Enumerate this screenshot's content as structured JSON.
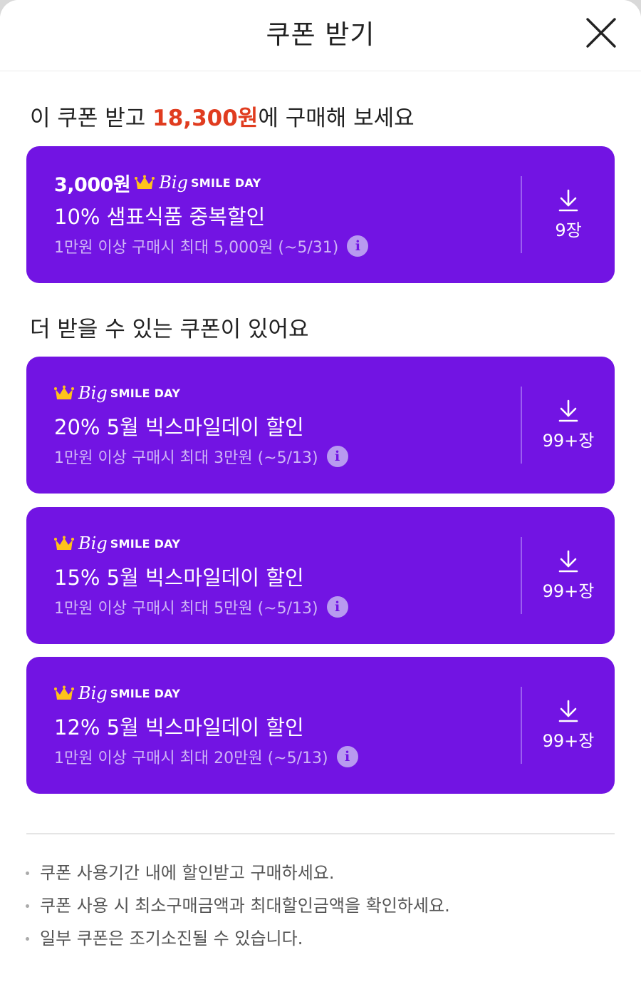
{
  "header": {
    "title": "쿠폰 받기"
  },
  "applied": {
    "title_prefix": "이 쿠폰 받고 ",
    "price": "18,300원",
    "title_suffix": "에 구매해 보세요",
    "coupon": {
      "amount": "3,000원",
      "brand_big": "Big",
      "brand_smile": "SMILE DAY",
      "title": "10% 샘표식품 중복할인",
      "condition": "1만원 이상 구매시 최대 5,000원 (~5/31)",
      "count": "9장"
    }
  },
  "more": {
    "title": "더 받을 수 있는 쿠폰이 있어요",
    "coupons": [
      {
        "brand_big": "Big",
        "brand_smile": "SMILE DAY",
        "title": "20% 5월 빅스마일데이 할인",
        "condition": "1만원 이상 구매시 최대 3만원 (~5/13)",
        "count": "99+장"
      },
      {
        "brand_big": "Big",
        "brand_smile": "SMILE DAY",
        "title": "15% 5월 빅스마일데이 할인",
        "condition": "1만원 이상 구매시 최대 5만원 (~5/13)",
        "count": "99+장"
      },
      {
        "brand_big": "Big",
        "brand_smile": "SMILE DAY",
        "title": "12% 5월 빅스마일데이 할인",
        "condition": "1만원 이상 구매시 최대 20만원 (~5/13)",
        "count": "99+장"
      }
    ]
  },
  "notes": [
    "쿠폰 사용기간 내에 할인받고 구매하세요.",
    "쿠폰 사용 시 최소구매금액과 최대할인금액을 확인하세요.",
    "일부 쿠폰은 조기소진될 수 있습니다."
  ],
  "icons": {
    "close": "close-icon",
    "crown": "crown-icon",
    "info": "info-icon",
    "download": "download-icon"
  },
  "colors": {
    "coupon_bg": "#7214e3",
    "price_accent": "#e03c1f",
    "crown": "#ffc21a"
  }
}
